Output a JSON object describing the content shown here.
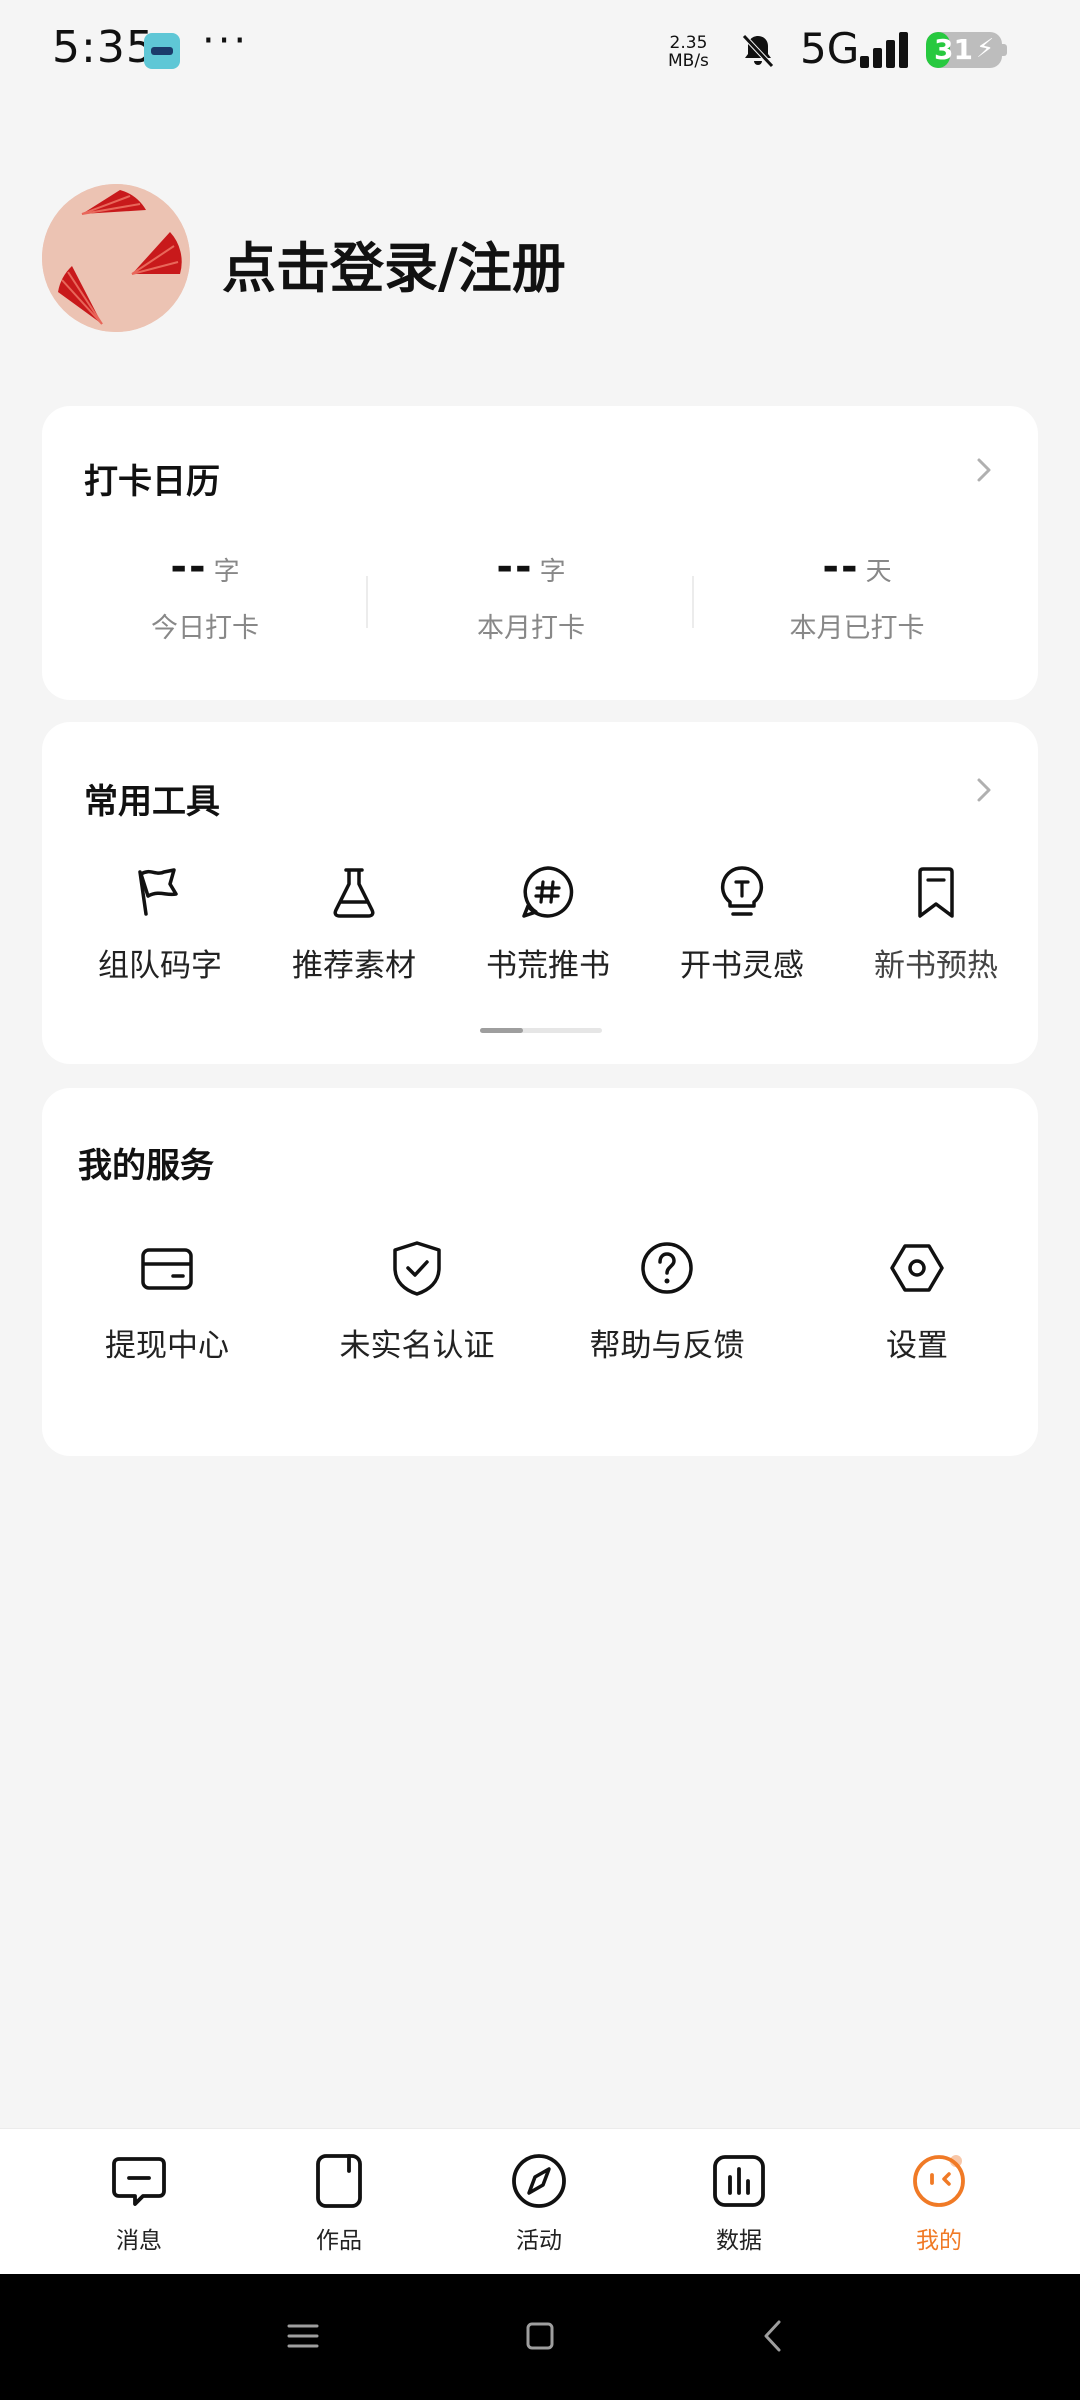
{
  "status_bar": {
    "time": "5:35",
    "more": "···",
    "net_speed_value": "2.35",
    "net_speed_unit": "MB/s",
    "network": "5G",
    "battery": "31",
    "battery_fraction": 0.31,
    "icons": [
      "app-notification-icon",
      "bell-muted-icon",
      "signal-icon",
      "battery-charging-icon"
    ]
  },
  "profile": {
    "login_text": "点击登录/注册"
  },
  "checkin_card": {
    "title": "打卡日历",
    "stats": [
      {
        "value": "--",
        "unit": "字",
        "label": "今日打卡"
      },
      {
        "value": "--",
        "unit": "字",
        "label": "本月打卡"
      },
      {
        "value": "--",
        "unit": "天",
        "label": "本月已打卡"
      }
    ]
  },
  "tools_card": {
    "title": "常用工具",
    "items": [
      {
        "label": "组队码字",
        "icon": "flag-icon"
      },
      {
        "label": "推荐素材",
        "icon": "flask-icon"
      },
      {
        "label": "书荒推书",
        "icon": "hashtag-bubble-icon"
      },
      {
        "label": "开书灵感",
        "icon": "lightbulb-icon"
      },
      {
        "label": "新书预热",
        "icon": "bookmark-icon"
      }
    ],
    "scroll_fraction": 0.35
  },
  "services_card": {
    "title": "我的服务",
    "items": [
      {
        "label": "提现中心",
        "icon": "card-icon"
      },
      {
        "label": "未实名认证",
        "icon": "shield-check-icon"
      },
      {
        "label": "帮助与反馈",
        "icon": "question-circle-icon"
      },
      {
        "label": "设置",
        "icon": "settings-hexagon-icon"
      }
    ]
  },
  "bottom_nav": {
    "items": [
      {
        "label": "消息",
        "icon": "message-icon"
      },
      {
        "label": "作品",
        "icon": "book-icon"
      },
      {
        "label": "活动",
        "icon": "compass-icon"
      },
      {
        "label": "数据",
        "icon": "bar-chart-icon"
      },
      {
        "label": "我的",
        "icon": "profile-face-icon"
      }
    ],
    "active_index": 4
  },
  "colors": {
    "accent": "#f07a26",
    "background": "#f5f5f5",
    "card": "#ffffff",
    "battery_fill": "#27c93f"
  }
}
